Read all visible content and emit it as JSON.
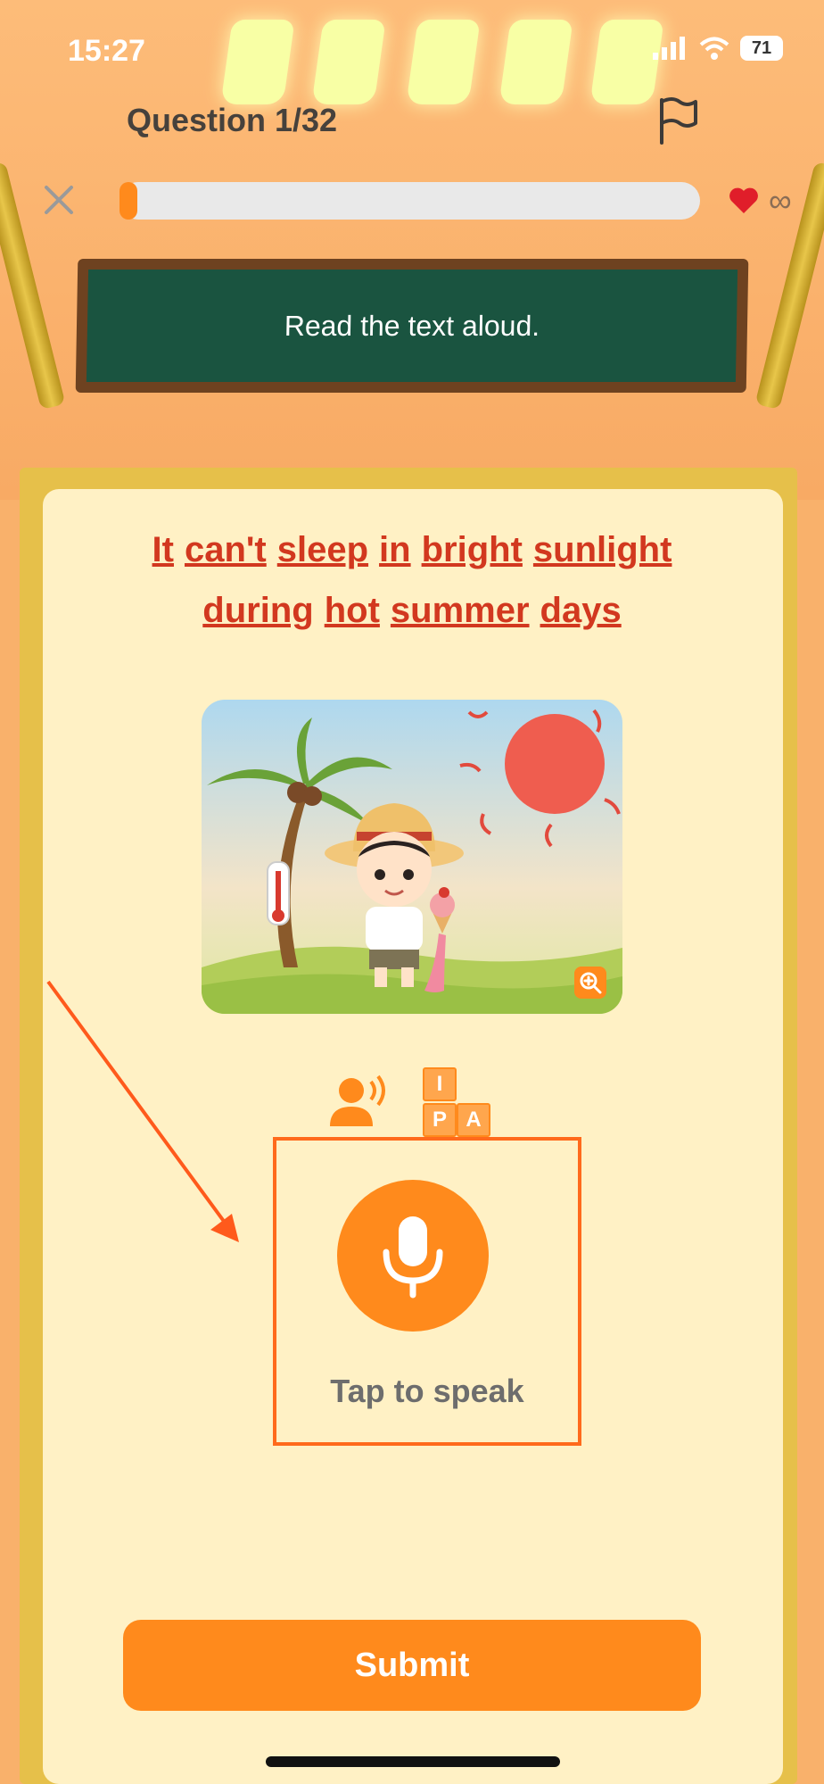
{
  "status_bar": {
    "time": "15:27",
    "battery": "71"
  },
  "header": {
    "question_counter": "Question 1/32",
    "progress": 0.02,
    "lives": "∞"
  },
  "instruction": "Read the text aloud.",
  "sentence_words": {
    "w1": "It",
    "w2": "can't",
    "w3": "sleep",
    "w4": "in",
    "w5": "bright",
    "w6": "sunlight",
    "w7": "during",
    "w8": "hot",
    "w9": "summer",
    "w10": "days"
  },
  "ipa_blocks": [
    "I",
    "P",
    "A"
  ],
  "speak": {
    "label": "Tap to speak"
  },
  "submit_label": "Submit",
  "colors": {
    "accent": "#ff8a1c",
    "sentence": "#d2381f",
    "board": "#1a5440"
  },
  "icons": [
    "close-icon",
    "flag-icon",
    "heart-icon",
    "speaker-person-icon",
    "ipa-blocks-icon",
    "microphone-icon",
    "zoom-in-icon"
  ]
}
